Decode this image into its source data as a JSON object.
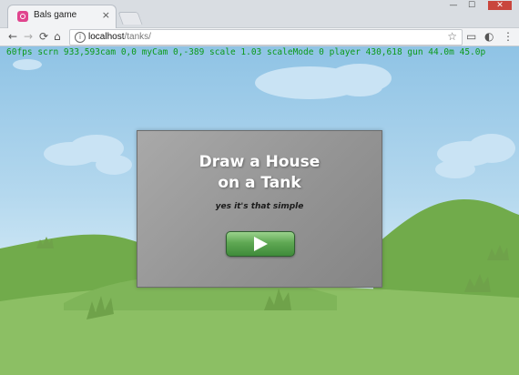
{
  "browser": {
    "tab_title": "Bals game",
    "tab_close": "×",
    "window_buttons": {
      "minimize": "—",
      "maximize": "☐",
      "close": "✕"
    },
    "nav": {
      "back": "←",
      "forward": "→",
      "reload": "⟳",
      "home": "⌂",
      "info": "i",
      "star": "☆",
      "cast": "▭",
      "extension": "◐",
      "menu": "⋮"
    },
    "url_host": "localhost",
    "url_path": "/tanks/"
  },
  "game": {
    "debug_text": "60fps scrn 933,593cam 0,0 myCam 0,-389 scale 1.03 scaleMode 0 player 430,618 gun 44.0m 45.0p",
    "title_line1": "Draw a House",
    "title_line2": "on a Tank",
    "subtitle": "yes it's that simple",
    "colors": {
      "debug": "#0c9a19",
      "panel": "#949494",
      "play_button": "#5fa853",
      "sky": "#b4d8ee",
      "hill_front": "#8cbf64",
      "hill_back": "#71ab4b"
    }
  }
}
